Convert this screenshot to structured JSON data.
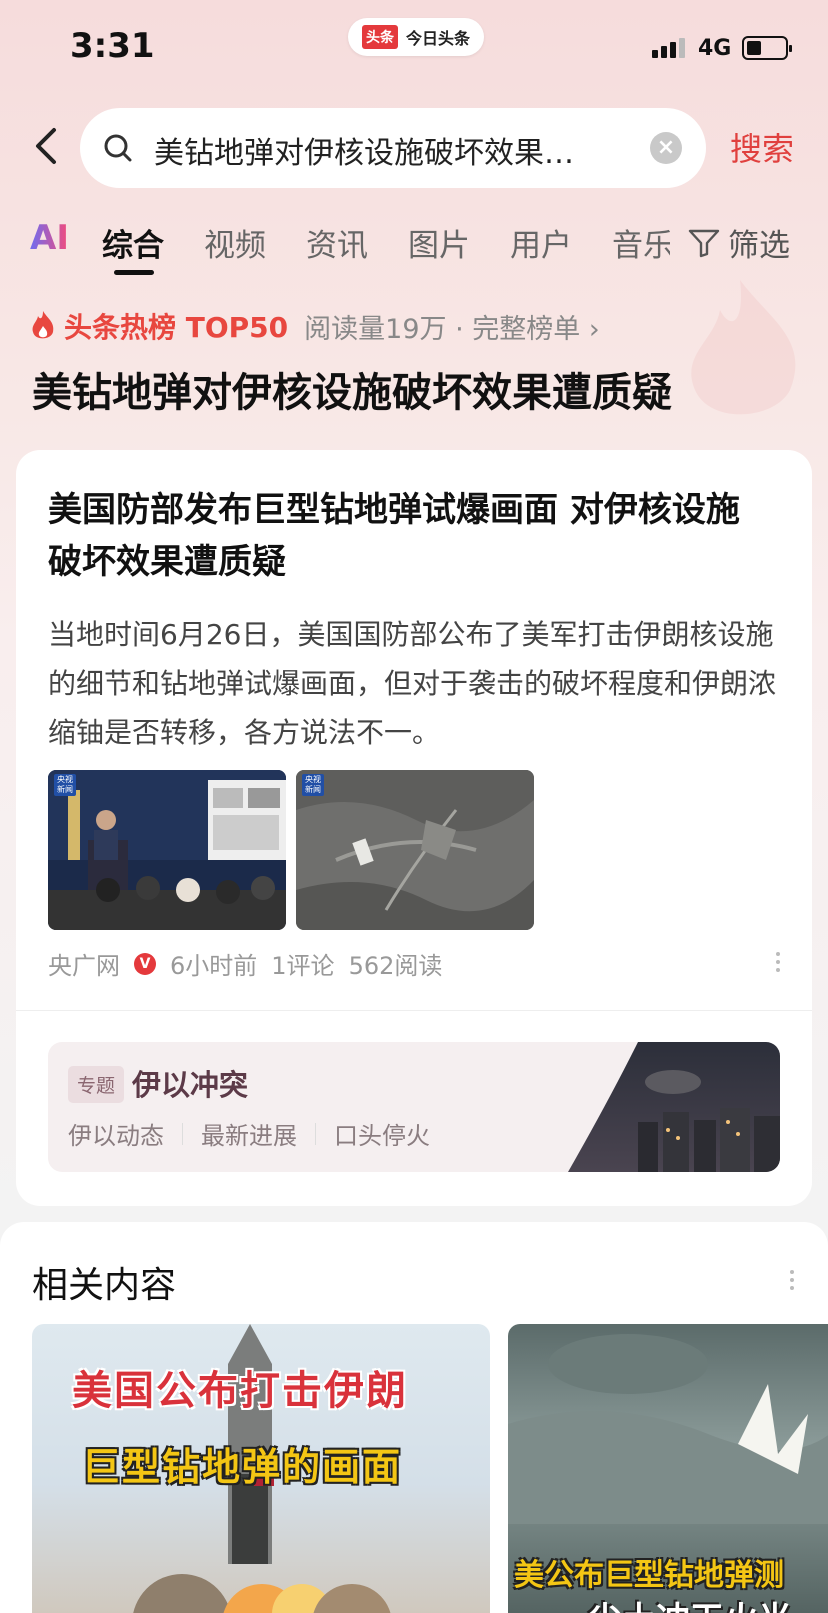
{
  "status_bar": {
    "time": "3:31",
    "app_logo": "头条",
    "app_name": "今日头条",
    "network": "4G"
  },
  "search": {
    "query": "美钻地弹对伊核设施破坏效果…",
    "button": "搜索"
  },
  "tabs": {
    "ai": "AI",
    "items": [
      "综合",
      "视频",
      "资讯",
      "图片",
      "用户",
      "音乐"
    ],
    "active": "综合",
    "filter": "筛选"
  },
  "hot": {
    "label": "头条热榜 TOP50",
    "meta": "阅读量19万 · 完整榜单 ›",
    "title": "美钻地弹对伊核设施破坏效果遭质疑"
  },
  "article": {
    "title": "美国防部发布巨型钻地弹试爆画面 对伊核设施破坏效果遭质疑",
    "description": "当地时间6月26日，美国国防部公布了美军打击伊朗核设施的细节和钻地弹试爆画面，但对于袭击的破坏程度和伊朗浓缩铀是否转移，各方说法不一。",
    "source": "央广网",
    "verified": "V",
    "time": "6小时前",
    "comments": "1评论",
    "reads": "562阅读",
    "image_tag": "央视新闻"
  },
  "topic": {
    "badge": "专题",
    "name": "伊以冲突",
    "links": [
      "伊以动态",
      "最新进展",
      "口头停火"
    ]
  },
  "related": {
    "title": "相关内容",
    "card1_caption_1": "美国公布打击伊朗",
    "card1_caption_2": "巨型钻地弹的画面",
    "card2_caption_1": "美公布巨型钻地弹测",
    "card2_caption_2": "尘土冲天火光"
  },
  "colors": {
    "accent_red": "#e0403e",
    "hot_red": "#e8473f"
  }
}
